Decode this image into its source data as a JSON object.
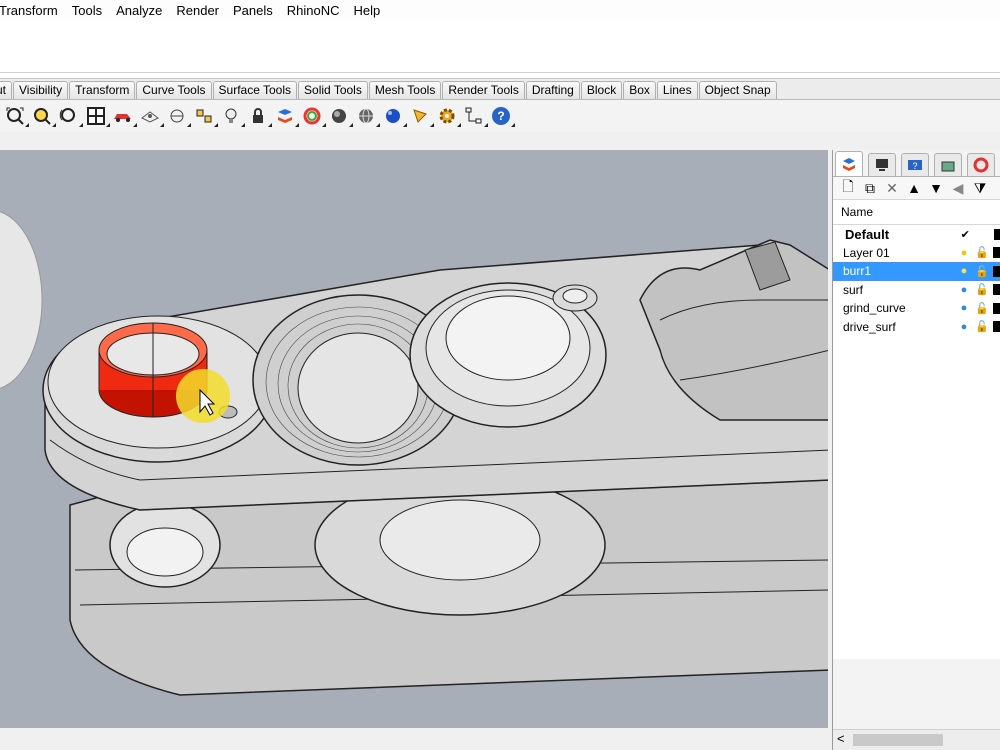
{
  "menu": [
    "Transform",
    "Tools",
    "Analyze",
    "Render",
    "Panels",
    "RhinoNC",
    "Help"
  ],
  "tabs": [
    "ut",
    "Visibility",
    "Transform",
    "Curve Tools",
    "Surface Tools",
    "Solid Tools",
    "Mesh Tools",
    "Render Tools",
    "Drafting",
    "Block",
    "Box",
    "Lines",
    "Object Snap"
  ],
  "toolbar_icons": [
    "zoom-extents-icon",
    "zoom-window-icon",
    "rotate-view-icon",
    "four-viewports-icon",
    "car-render-icon",
    "named-views-icon",
    "clipping-plane-icon",
    "snapshot-icon",
    "light-icon",
    "lock-icon",
    "layer-icon",
    "color-wheel-icon",
    "shaded-sphere-icon",
    "wireframe-sphere-icon",
    "rendered-sphere-icon",
    "pencil-icon",
    "settings-gear-icon",
    "flowchart-icon",
    "help-icon"
  ],
  "panel": {
    "tab_icons": [
      "layers-tab-icon",
      "display-tab-icon",
      "help-tab-icon",
      "render-tab-icon",
      "color-tab-icon"
    ],
    "tool_icons": [
      "new-layer-icon",
      "new-sublayer-icon",
      "delete-icon",
      "move-up-icon",
      "move-down-icon",
      "move-left-icon",
      "filter-icon"
    ],
    "header": "Name",
    "layers": [
      {
        "name": "Default",
        "current": "✔"
      },
      {
        "name": "Layer 01"
      },
      {
        "name": "burr1"
      },
      {
        "name": "surf"
      },
      {
        "name": "grind_curve"
      },
      {
        "name": "drive_surf"
      }
    ],
    "scroll_left": "<"
  },
  "colors": {
    "accent": "#3399ff",
    "viewport": "#a8aeb7",
    "highlight": "#ff2a00"
  }
}
